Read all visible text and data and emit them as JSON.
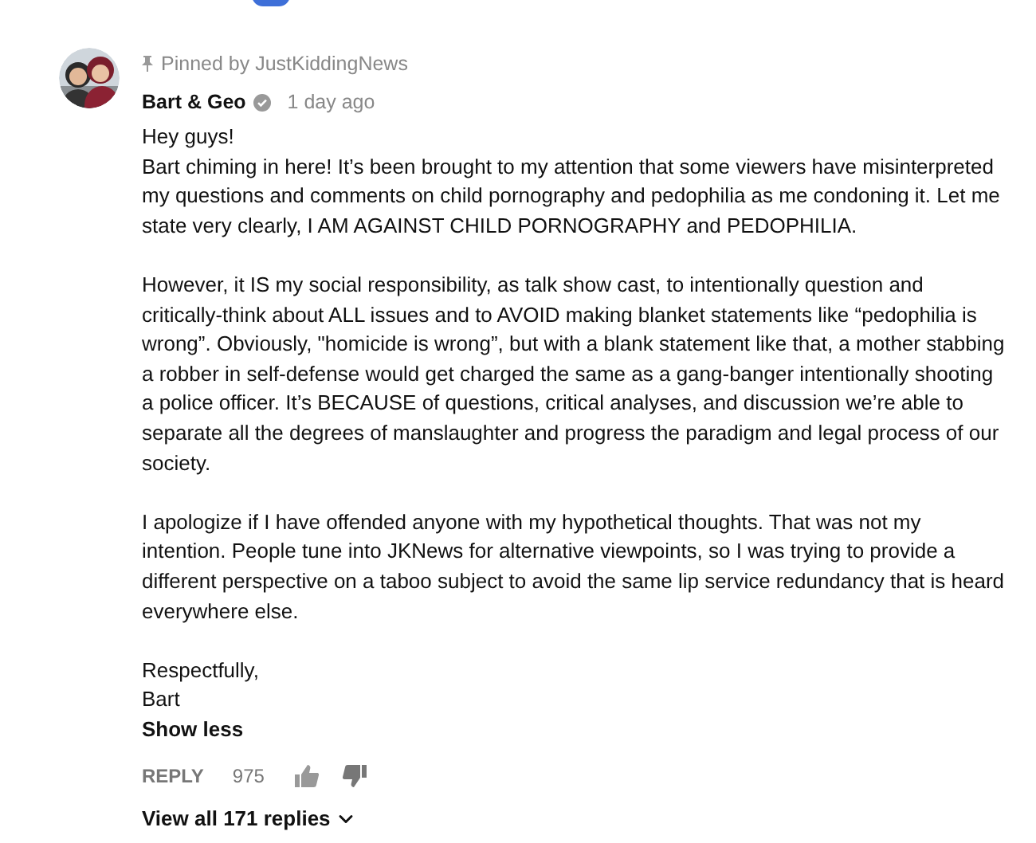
{
  "comment": {
    "pinned_by": "Pinned by JustKiddingNews",
    "author": "Bart & Geo",
    "verified": true,
    "time": "1 day ago",
    "paragraphs": [
      [
        "Hey guys!",
        "Bart chiming in here! It’s been brought to my attention that some viewers have misinterpreted",
        "my questions and comments on child pornography and pedophilia as me condoning it. Let me",
        "state very clearly, I AM AGAINST CHILD PORNOGRAPHY and PEDOPHILIA."
      ],
      [
        "However, it IS my social responsibility, as talk show cast, to intentionally question and",
        "critically-think about ALL issues and to AVOID making blanket statements like “pedophilia is",
        "wrong”. Obviously, \"homicide is wrong”, but with a blank statement like that, a mother stabbing",
        "a robber in self-defense would get charged the same as a gang-banger intentionally shooting",
        "a police officer. It’s BECAUSE of questions, critical analyses, and discussion we’re able to",
        "separate all the degrees of manslaughter and progress the paradigm and legal process of our",
        "society."
      ],
      [
        "I apologize if I have offended anyone with my hypothetical thoughts. That was not my",
        "intention. People tune into JKNews for alternative viewpoints, so I was trying to provide a",
        "different perspective on a taboo subject to avoid the same lip service redundancy that is heard",
        "everywhere else."
      ],
      [
        "Respectfully,",
        "Bart"
      ]
    ],
    "toggle": "Show less",
    "reply": "REPLY",
    "likes": "975",
    "view_replies": "View all 171 replies"
  }
}
